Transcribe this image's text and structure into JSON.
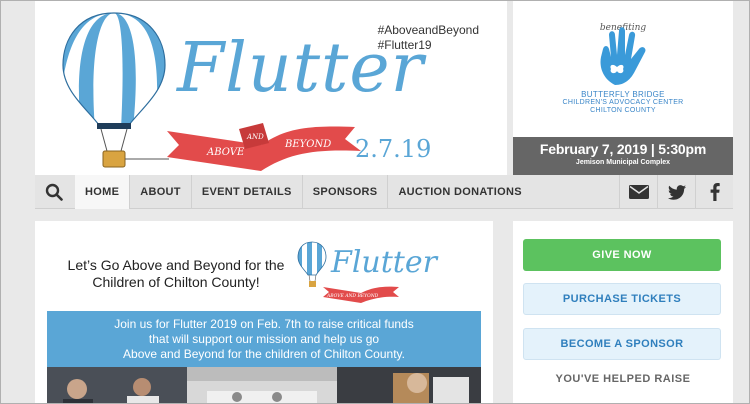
{
  "banner": {
    "hashtags": [
      "#AboveandBeyond",
      "#Flutter19"
    ],
    "wordmark": "Flutter",
    "ribbon_left": "ABOVE",
    "ribbon_mid": "AND",
    "ribbon_right": "BEYOND",
    "event_date": "2.7.19",
    "balloon_colors": {
      "blue": "#5aa6d6",
      "white": "#ffffff",
      "ribbon": "#e24b4b"
    }
  },
  "benefit": {
    "label": "benefiting",
    "org_line1": "BUTTERFLY BRIDGE",
    "org_line2": "CHILDREN'S ADVOCACY CENTER",
    "org_line3": "CHILTON COUNTY",
    "date_time": "February 7, 2019 | 5:30pm",
    "venue": "Jemison Municipal Complex"
  },
  "nav": {
    "items": [
      "HOME",
      "ABOUT",
      "EVENT DETAILS",
      "SPONSORS",
      "AUCTION DONATIONS"
    ],
    "active_index": 0,
    "social_icons": [
      "email-icon",
      "twitter-icon",
      "facebook-icon"
    ]
  },
  "promo": {
    "headline_line1": "Let’s Go Above and Beyond for the",
    "headline_line2": "Children of Chilton County!",
    "mini_wordmark": "Flutter",
    "mini_ribbon": "ABOVE AND BEYOND",
    "body_line1": "Join us for Flutter 2019 on Feb. 7th to raise critical funds",
    "body_line2": "that will support our mission and help us go",
    "body_line3": "Above and Beyond for the children of Chilton County."
  },
  "sidebar": {
    "give_now": "GIVE NOW",
    "purchase_tickets": "PURCHASE TICKETS",
    "become_sponsor": "BECOME A SPONSOR",
    "helped_raise": "YOU'VE HELPED RAISE"
  },
  "colors": {
    "accent_blue": "#5aa6d6",
    "give_green": "#5cc25f",
    "date_bar_gray": "#666666"
  }
}
